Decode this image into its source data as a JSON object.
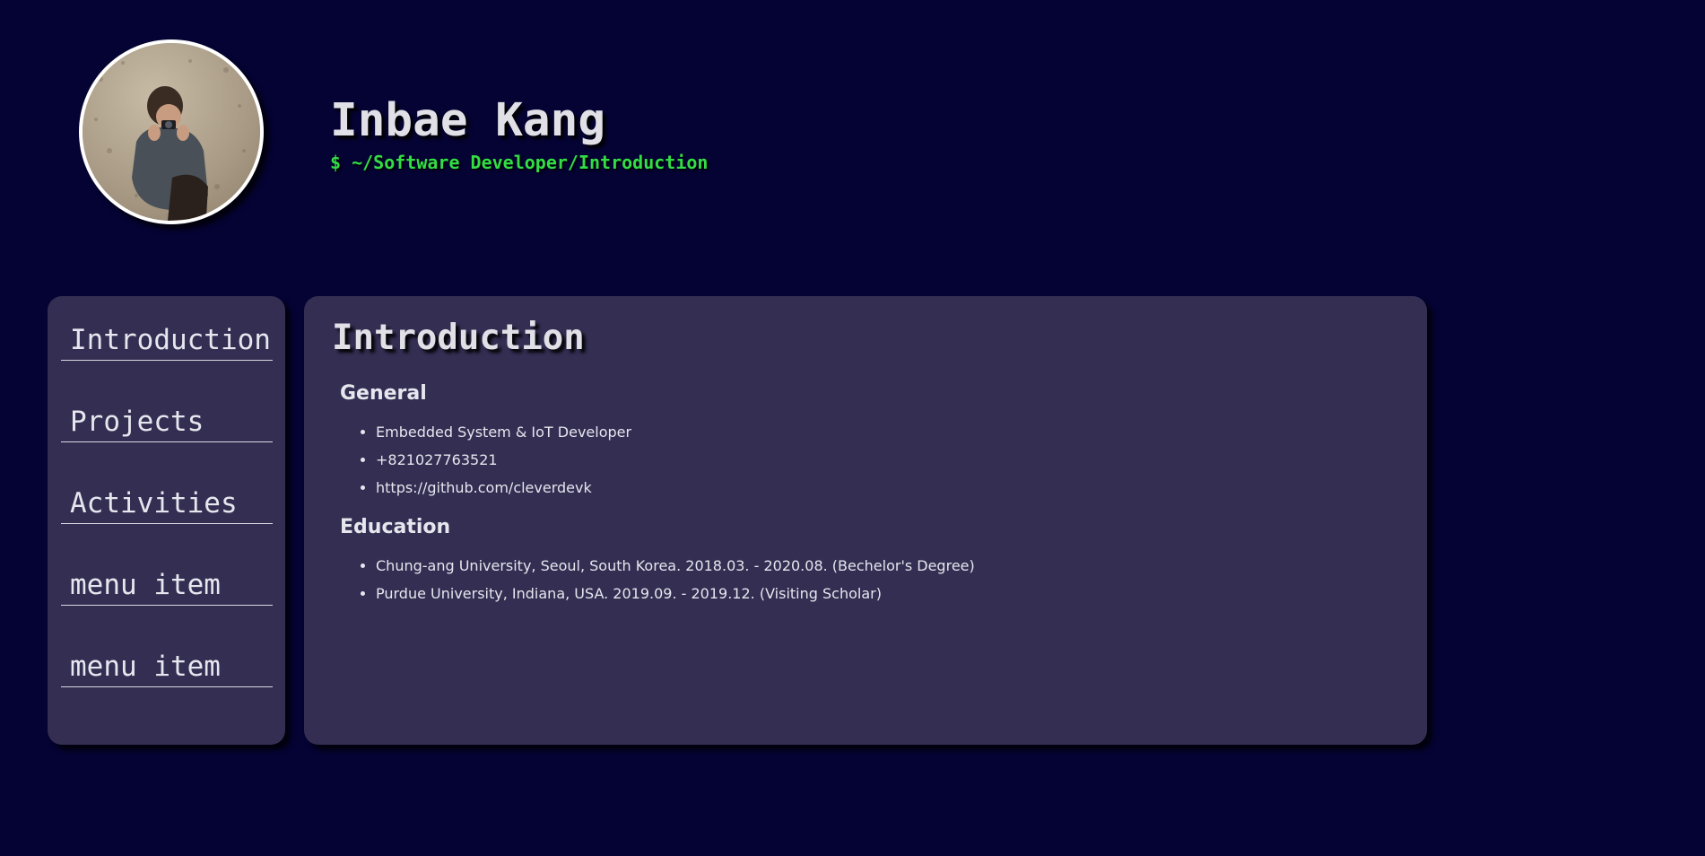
{
  "header": {
    "name": "Inbae Kang",
    "subtitle": "$ ~/Software Developer/Introduction"
  },
  "sidebar": {
    "items": [
      {
        "label": "Introduction"
      },
      {
        "label": "Projects"
      },
      {
        "label": "Activities"
      },
      {
        "label": "menu item"
      },
      {
        "label": "menu item"
      }
    ]
  },
  "main": {
    "title": "Introduction",
    "sections": [
      {
        "heading": "General",
        "items": [
          "Embedded System & IoT Developer",
          "+821027763521",
          "https://github.com/cleverdevk"
        ]
      },
      {
        "heading": "Education",
        "items": [
          "Chung-ang University, Seoul, South Korea. 2018.03. - 2020.08. (Bechelor's Degree)",
          "Purdue University, Indiana, USA. 2019.09. - 2019.12. (Visiting Scholar)"
        ]
      }
    ]
  },
  "colors": {
    "background": "#050333",
    "panel": "#332e52",
    "accent_green": "#33dd44",
    "text": "#e6e6ee"
  }
}
